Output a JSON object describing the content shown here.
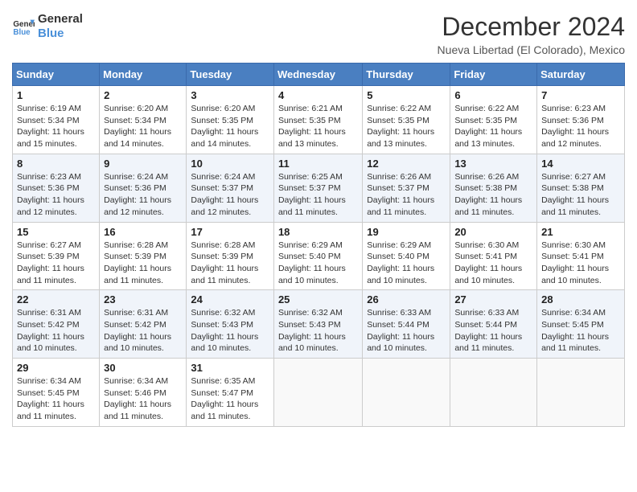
{
  "logo": {
    "line1": "General",
    "line2": "Blue"
  },
  "title": "December 2024",
  "subtitle": "Nueva Libertad (El Colorado), Mexico",
  "weekdays": [
    "Sunday",
    "Monday",
    "Tuesday",
    "Wednesday",
    "Thursday",
    "Friday",
    "Saturday"
  ],
  "weeks": [
    [
      {
        "day": "1",
        "info": "Sunrise: 6:19 AM\nSunset: 5:34 PM\nDaylight: 11 hours\nand 15 minutes."
      },
      {
        "day": "2",
        "info": "Sunrise: 6:20 AM\nSunset: 5:34 PM\nDaylight: 11 hours\nand 14 minutes."
      },
      {
        "day": "3",
        "info": "Sunrise: 6:20 AM\nSunset: 5:35 PM\nDaylight: 11 hours\nand 14 minutes."
      },
      {
        "day": "4",
        "info": "Sunrise: 6:21 AM\nSunset: 5:35 PM\nDaylight: 11 hours\nand 13 minutes."
      },
      {
        "day": "5",
        "info": "Sunrise: 6:22 AM\nSunset: 5:35 PM\nDaylight: 11 hours\nand 13 minutes."
      },
      {
        "day": "6",
        "info": "Sunrise: 6:22 AM\nSunset: 5:35 PM\nDaylight: 11 hours\nand 13 minutes."
      },
      {
        "day": "7",
        "info": "Sunrise: 6:23 AM\nSunset: 5:36 PM\nDaylight: 11 hours\nand 12 minutes."
      }
    ],
    [
      {
        "day": "8",
        "info": "Sunrise: 6:23 AM\nSunset: 5:36 PM\nDaylight: 11 hours\nand 12 minutes."
      },
      {
        "day": "9",
        "info": "Sunrise: 6:24 AM\nSunset: 5:36 PM\nDaylight: 11 hours\nand 12 minutes."
      },
      {
        "day": "10",
        "info": "Sunrise: 6:24 AM\nSunset: 5:37 PM\nDaylight: 11 hours\nand 12 minutes."
      },
      {
        "day": "11",
        "info": "Sunrise: 6:25 AM\nSunset: 5:37 PM\nDaylight: 11 hours\nand 11 minutes."
      },
      {
        "day": "12",
        "info": "Sunrise: 6:26 AM\nSunset: 5:37 PM\nDaylight: 11 hours\nand 11 minutes."
      },
      {
        "day": "13",
        "info": "Sunrise: 6:26 AM\nSunset: 5:38 PM\nDaylight: 11 hours\nand 11 minutes."
      },
      {
        "day": "14",
        "info": "Sunrise: 6:27 AM\nSunset: 5:38 PM\nDaylight: 11 hours\nand 11 minutes."
      }
    ],
    [
      {
        "day": "15",
        "info": "Sunrise: 6:27 AM\nSunset: 5:39 PM\nDaylight: 11 hours\nand 11 minutes."
      },
      {
        "day": "16",
        "info": "Sunrise: 6:28 AM\nSunset: 5:39 PM\nDaylight: 11 hours\nand 11 minutes."
      },
      {
        "day": "17",
        "info": "Sunrise: 6:28 AM\nSunset: 5:39 PM\nDaylight: 11 hours\nand 11 minutes."
      },
      {
        "day": "18",
        "info": "Sunrise: 6:29 AM\nSunset: 5:40 PM\nDaylight: 11 hours\nand 10 minutes."
      },
      {
        "day": "19",
        "info": "Sunrise: 6:29 AM\nSunset: 5:40 PM\nDaylight: 11 hours\nand 10 minutes."
      },
      {
        "day": "20",
        "info": "Sunrise: 6:30 AM\nSunset: 5:41 PM\nDaylight: 11 hours\nand 10 minutes."
      },
      {
        "day": "21",
        "info": "Sunrise: 6:30 AM\nSunset: 5:41 PM\nDaylight: 11 hours\nand 10 minutes."
      }
    ],
    [
      {
        "day": "22",
        "info": "Sunrise: 6:31 AM\nSunset: 5:42 PM\nDaylight: 11 hours\nand 10 minutes."
      },
      {
        "day": "23",
        "info": "Sunrise: 6:31 AM\nSunset: 5:42 PM\nDaylight: 11 hours\nand 10 minutes."
      },
      {
        "day": "24",
        "info": "Sunrise: 6:32 AM\nSunset: 5:43 PM\nDaylight: 11 hours\nand 10 minutes."
      },
      {
        "day": "25",
        "info": "Sunrise: 6:32 AM\nSunset: 5:43 PM\nDaylight: 11 hours\nand 10 minutes."
      },
      {
        "day": "26",
        "info": "Sunrise: 6:33 AM\nSunset: 5:44 PM\nDaylight: 11 hours\nand 10 minutes."
      },
      {
        "day": "27",
        "info": "Sunrise: 6:33 AM\nSunset: 5:44 PM\nDaylight: 11 hours\nand 11 minutes."
      },
      {
        "day": "28",
        "info": "Sunrise: 6:34 AM\nSunset: 5:45 PM\nDaylight: 11 hours\nand 11 minutes."
      }
    ],
    [
      {
        "day": "29",
        "info": "Sunrise: 6:34 AM\nSunset: 5:45 PM\nDaylight: 11 hours\nand 11 minutes."
      },
      {
        "day": "30",
        "info": "Sunrise: 6:34 AM\nSunset: 5:46 PM\nDaylight: 11 hours\nand 11 minutes."
      },
      {
        "day": "31",
        "info": "Sunrise: 6:35 AM\nSunset: 5:47 PM\nDaylight: 11 hours\nand 11 minutes."
      },
      null,
      null,
      null,
      null
    ]
  ]
}
